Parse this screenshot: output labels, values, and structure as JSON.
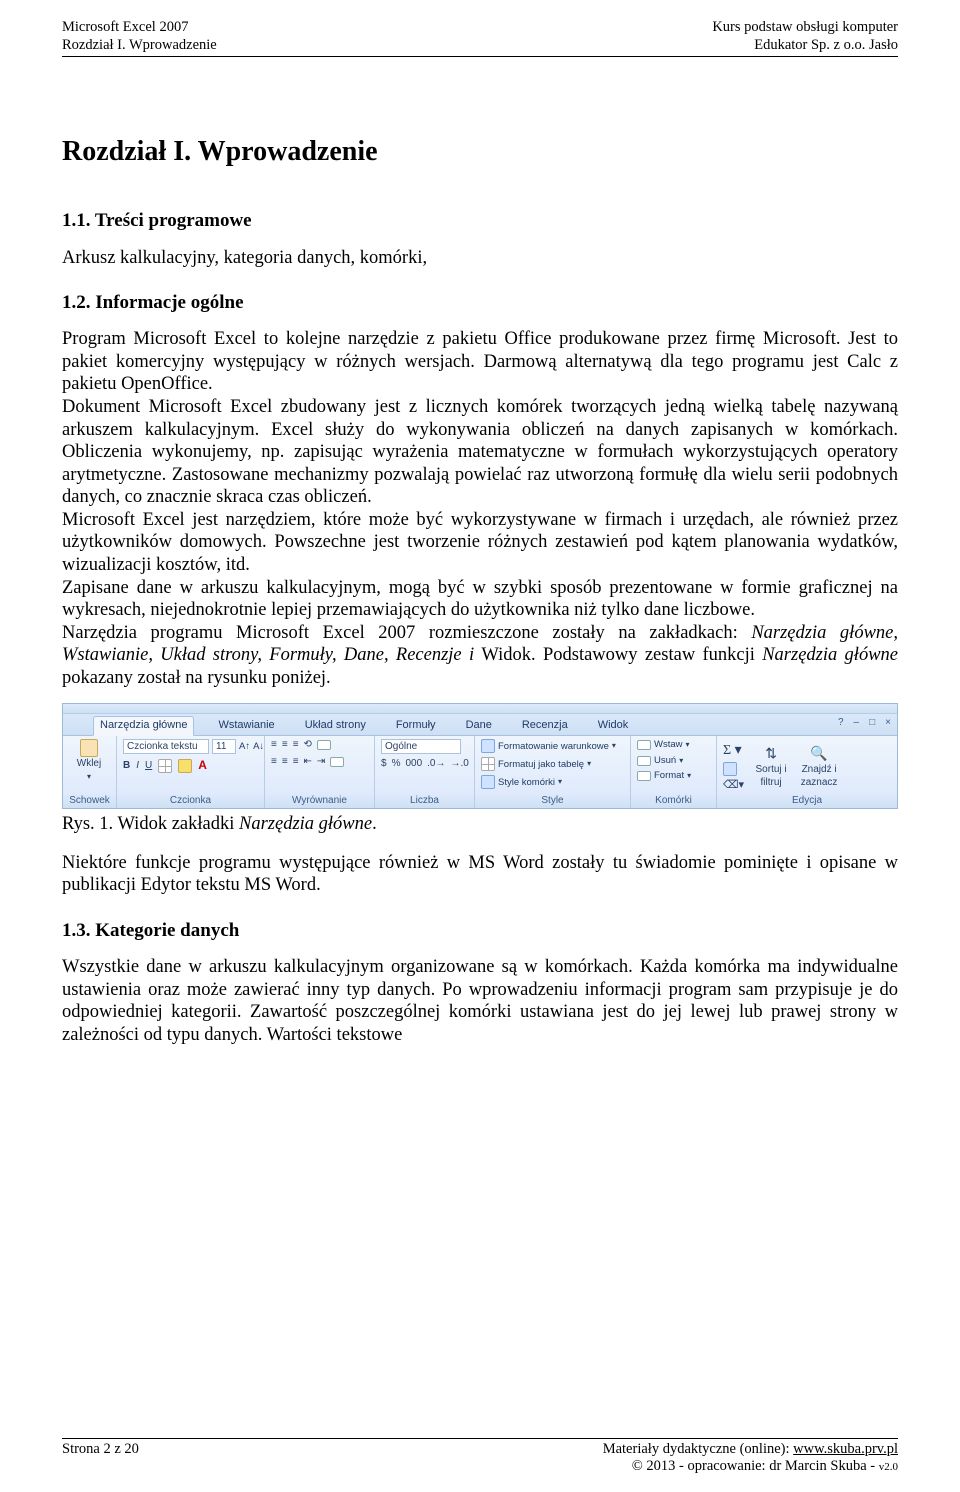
{
  "header": {
    "left1": "Microsoft Excel 2007",
    "left2": "Rozdział I. Wprowadzenie",
    "right1": "Kurs podstaw obsługi komputer",
    "right2": "Edukator Sp. z o.o. Jasło"
  },
  "chapter_title": "Rozdział I. Wprowadzenie",
  "s11": {
    "title": "1.1. Treści programowe",
    "body": "Arkusz kalkulacyjny, kategoria danych, komórki,"
  },
  "s12": {
    "title": "1.2. Informacje ogólne",
    "p1a": "Program Microsoft Excel to kolejne narzędzie z pakietu Office produkowane przez firmę Microsoft. Jest to pakiet komercyjny występujący w różnych wersjach. Darmową alternatywą dla tego programu jest Calc z pakietu OpenOffice.",
    "p1b": "Dokument Microsoft Excel zbudowany jest z licznych komórek tworzących jedną wielką tabelę nazywaną arkuszem kalkulacyjnym. Excel służy do wykonywania obliczeń na danych zapisanych w komórkach. Obliczenia wykonujemy, np. zapisując wyrażenia matematyczne w formułach wykorzystujących operatory arytmetyczne. Zastosowane mechanizmy pozwalają powielać raz utworzoną formułę dla wielu serii podobnych danych, co znacznie skraca czas obliczeń.",
    "p1c": "Microsoft Excel jest narzędziem, które może być wykorzystywane w firmach i urzędach, ale również przez użytkowników domowych. Powszechne jest tworzenie różnych zestawień pod kątem planowania wydatków, wizualizacji kosztów, itd.",
    "p1d": "Zapisane dane w arkuszu kalkulacyjnym, mogą być w szybki sposób prezentowane w formie graficznej na wykresach, niejednokrotnie lepiej przemawiających do użytkownika niż tylko dane liczbowe.",
    "p1e_a": "Narzędzia programu Microsoft Excel 2007 rozmieszczone zostały na zakładkach: ",
    "p1e_italic": "Narzędzia główne, Wstawianie, Układ strony, Formuły, Dane, Recenzje i ",
    "p1e_b": "Widok. Podstawowy zestaw funkcji ",
    "p1e_italic2": "Narzędzia główne",
    "p1e_c": " pokazany został na rysunku poniżej."
  },
  "ribbon": {
    "tabs": [
      "Narzędzia główne",
      "Wstawianie",
      "Układ strony",
      "Formuły",
      "Dane",
      "Recenzja",
      "Widok"
    ],
    "groups": {
      "clipboard": {
        "label": "Schowek",
        "paste": "Wklej"
      },
      "font": {
        "label": "Czcionka",
        "name": "Czcionka tekstu",
        "size": "11"
      },
      "align": {
        "label": "Wyrównanie"
      },
      "number": {
        "label": "Liczba",
        "format": "Ogólne"
      },
      "styles": {
        "label": "Style",
        "cond": "Formatowanie warunkowe",
        "table": "Formatuj jako tabelę",
        "cell": "Style komórki"
      },
      "cells": {
        "label": "Komórki",
        "insert": "Wstaw",
        "delete": "Usuń",
        "format": "Format"
      },
      "editing": {
        "label": "Edycja",
        "sort1": "Sortuj i",
        "sort2": "filtruj",
        "find1": "Znajdź i",
        "find2": "zaznacz"
      }
    }
  },
  "caption": {
    "a": "Rys. 1. Widok zakładki ",
    "italic": "Narzędzia główne",
    "b": "."
  },
  "after_fig": "Niektóre funkcje programu występujące również w MS Word zostały tu świadomie pominięte i opisane w publikacji Edytor tekstu MS Word.",
  "s13": {
    "title": "1.3. Kategorie danych",
    "body": "Wszystkie dane w arkuszu kalkulacyjnym organizowane są w komórkach. Każda komórka ma indywidualne ustawienia oraz może zawierać inny typ danych. Po wprowadzeniu informacji program sam przypisuje je do odpowiedniej kategorii. Zawartość poszczególnej komórki ustawiana jest do jej lewej lub prawej strony w zależności od typu danych. Wartości tekstowe"
  },
  "footer": {
    "page": "Strona 2 z 20",
    "online_label": "Materiały dydaktyczne  (online): ",
    "url": "www.skuba.prv.pl",
    "copy": "© 2013 - opracowanie: dr Marcin Skuba - ",
    "ver": "v2.0"
  }
}
